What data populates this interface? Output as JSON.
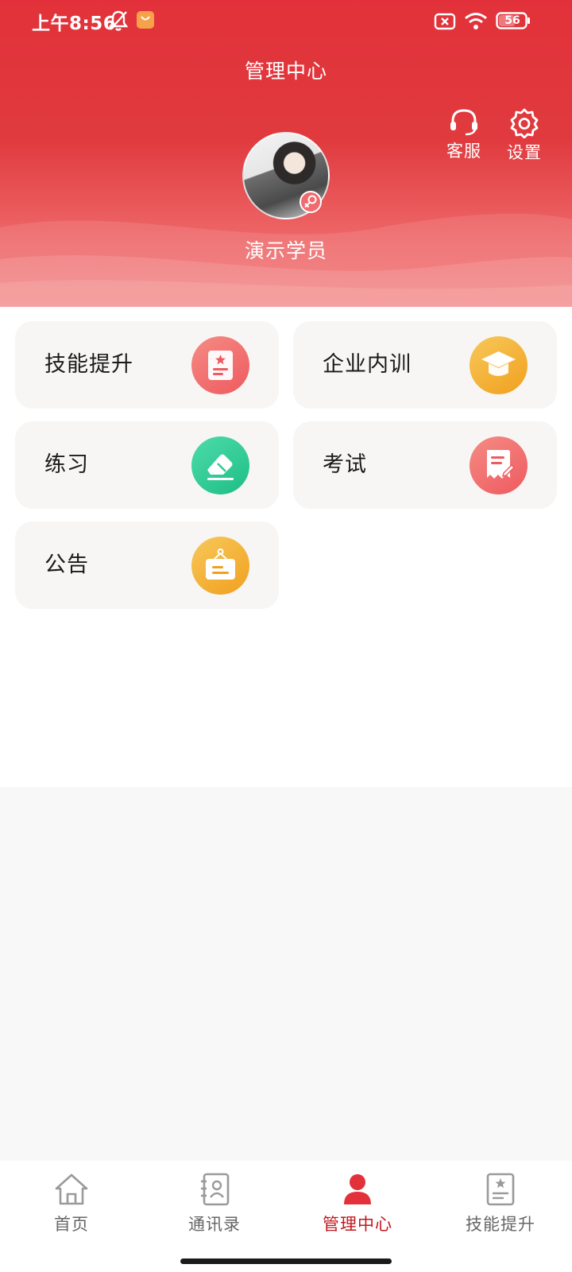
{
  "status_bar": {
    "time": "上午8:56",
    "battery": "56"
  },
  "header": {
    "title": "管理中心",
    "actions": [
      {
        "label": "客服",
        "icon": "headset-icon"
      },
      {
        "label": "设置",
        "icon": "gear-icon"
      }
    ],
    "user": {
      "name": "演示学员",
      "gender_icon": "female-icon"
    }
  },
  "menu": [
    {
      "label": "技能提升",
      "icon": "skill-book-icon",
      "color": "#f0676b"
    },
    {
      "label": "企业内训",
      "icon": "graduation-cap-icon",
      "color": "#f2b030"
    },
    {
      "label": "练习",
      "icon": "eraser-icon",
      "color": "#2ccb96"
    },
    {
      "label": "考试",
      "icon": "exam-paper-icon",
      "color": "#f0676b"
    },
    {
      "label": "公告",
      "icon": "notice-board-icon",
      "color": "#f2b030"
    }
  ],
  "tabs": [
    {
      "label": "首页",
      "icon": "home-icon",
      "active": false
    },
    {
      "label": "通讯录",
      "icon": "contacts-icon",
      "active": false
    },
    {
      "label": "管理中心",
      "icon": "person-icon",
      "active": true
    },
    {
      "label": "技能提升",
      "icon": "skill-book-icon",
      "active": false
    }
  ],
  "colors": {
    "brand_red": "#e2313a",
    "active_tab": "#c3161c"
  }
}
